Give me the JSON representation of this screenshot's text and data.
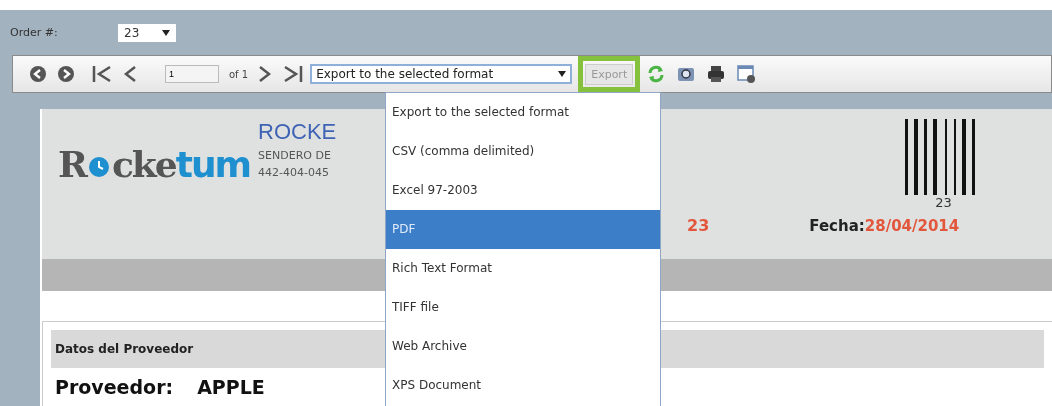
{
  "order": {
    "label": "Order #:",
    "value": "23"
  },
  "toolbar": {
    "page": "1",
    "of": "of 1",
    "format": "Export to the selected format",
    "export": "Export",
    "export_highlighted": true
  },
  "format_menu": {
    "expanded": true,
    "options": [
      {
        "label": "Export to the selected format",
        "selected": false
      },
      {
        "label": "CSV (comma delimited)",
        "selected": false
      },
      {
        "label": "Excel 97-2003",
        "selected": false
      },
      {
        "label": "PDF",
        "selected": true
      },
      {
        "label": "Rich Text Format",
        "selected": false
      },
      {
        "label": "TIFF file",
        "selected": false
      },
      {
        "label": "Web Archive",
        "selected": false
      },
      {
        "label": "XPS Document",
        "selected": false
      }
    ]
  },
  "report": {
    "logo": [
      "R",
      "cke",
      "tum"
    ],
    "company": "ROCKE",
    "address": "SENDERO DE",
    "phone": "442-404-045",
    "barcode_number": "23",
    "order_number": "23",
    "date_label": "Fecha:",
    "date": "28/04/2014",
    "section_title": "Datos del Proveedor",
    "supplier_label": "Proveedor:",
    "supplier": "APPLE"
  }
}
